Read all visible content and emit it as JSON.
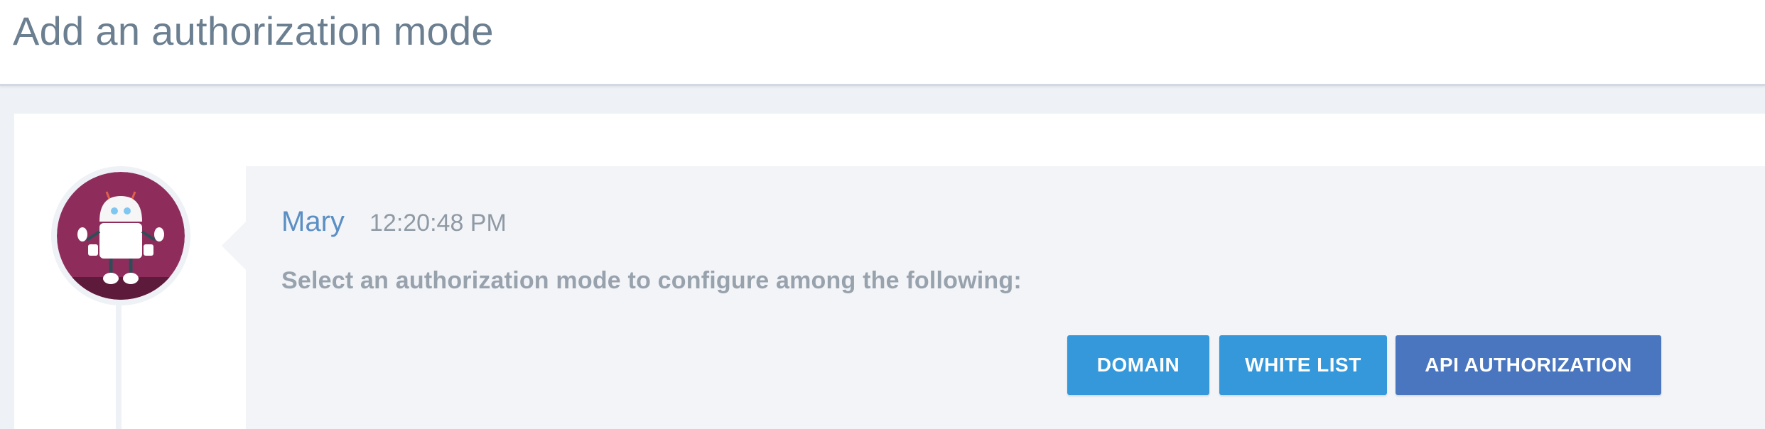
{
  "header": {
    "title": "Add an authorization mode"
  },
  "message": {
    "sender": "Mary",
    "time": "12:20:48 PM",
    "text": "Select an authorization mode to configure among the following:",
    "avatar_icon": "robot-icon"
  },
  "buttons": [
    {
      "label": "DOMAIN"
    },
    {
      "label": "WHITE LIST"
    },
    {
      "label": "API AUTHORIZATION"
    }
  ],
  "colors": {
    "title": "#6b7f91",
    "sender": "#5b8fc3",
    "avatar_bg": "#8e2d5c",
    "button_primary": "#3498db",
    "button_alt": "#4a76c0"
  }
}
